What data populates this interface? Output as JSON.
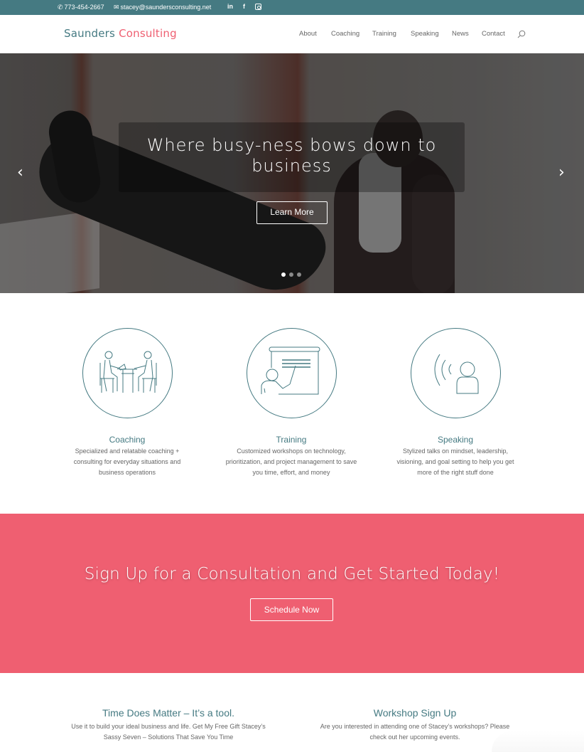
{
  "topbar": {
    "phone": "773-454-2667",
    "email": "stacey@saundersconsulting.net",
    "social": [
      {
        "name": "linkedin",
        "label": "in"
      },
      {
        "name": "facebook",
        "label": "f"
      },
      {
        "name": "instagram",
        "label": ""
      }
    ],
    "bg_color": "#457a82"
  },
  "header": {
    "logo_part1": "Saunders",
    "logo_part2": "Consulting",
    "nav": [
      "About",
      "Coaching",
      "Training",
      "Speaking",
      "News",
      "Contact"
    ]
  },
  "hero": {
    "title": "Where busy-ness bows down to business",
    "button": "Learn More",
    "slides": 3,
    "active_slide": 1,
    "prev_icon": "‹",
    "next_icon": "›"
  },
  "services": [
    {
      "title": "Coaching",
      "desc": "Specialized and relatable coaching + consulting for everyday situations and business operations",
      "icon": "meeting-icon"
    },
    {
      "title": "Training",
      "desc": "Customized workshops on technology, prioritization, and project management to save you time, effort, and money",
      "icon": "presentation-icon"
    },
    {
      "title": "Speaking",
      "desc": "Stylized talks on mindset, leadership, visioning, and goal setting to help you get more of the right stuff done",
      "icon": "speaker-icon"
    }
  ],
  "cta": {
    "title": "Sign Up for a Consultation and Get Started Today!",
    "button": "Schedule Now",
    "bg_color": "#ef5f71"
  },
  "bottom": [
    {
      "title": "Time Does Matter – It’s a tool.",
      "desc_line1": "Use it to build your ideal business and life. Get My Free Gift Stacey’s",
      "desc_line2": "Sassy Seven – Solutions That Save You Time"
    },
    {
      "title": "Workshop Sign Up",
      "desc_line1": "Are you interested in attending one of Stacey’s workshops? Please",
      "desc_line2": "check out her upcoming events."
    }
  ],
  "colors": {
    "accent": "#457a82",
    "brand_pink": "#ef5f71"
  }
}
